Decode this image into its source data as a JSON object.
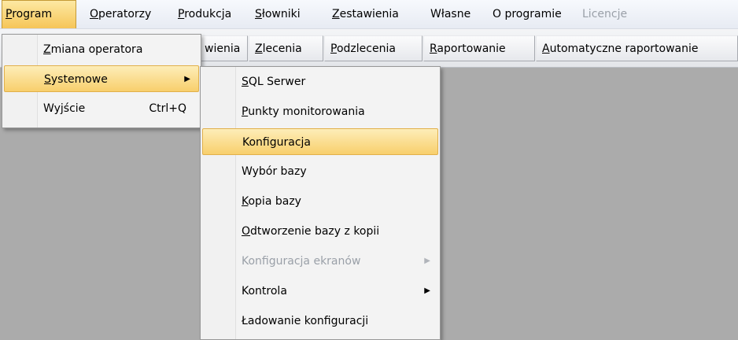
{
  "menubar": {
    "items": [
      {
        "label": "Program",
        "accel": "P",
        "rest": "rogram"
      },
      {
        "label": "Operatorzy",
        "accel": "O",
        "rest": "peratorzy"
      },
      {
        "label": "Produkcja",
        "accel": "P",
        "rest": "rodukcja"
      },
      {
        "label": "Słowniki",
        "accel": "S",
        "rest": "łowniki"
      },
      {
        "label": "Zestawienia",
        "accel": "Z",
        "rest": "estawienia"
      },
      {
        "label": "Własne"
      },
      {
        "label": "O programie"
      },
      {
        "label": "Licencje"
      }
    ]
  },
  "toolbar": {
    "buttons": [
      {
        "label": "wienia"
      },
      {
        "label": "Zlecenia",
        "accel": "Z",
        "rest": "lecenia"
      },
      {
        "label": "Podzlecenia",
        "accel": "P",
        "rest": "odzlecenia"
      },
      {
        "label": "Raportowanie",
        "accel": "R",
        "rest": "aportowanie"
      },
      {
        "label": "Automatyczne raportowanie",
        "accel": "A",
        "rest": "utomatyczne raportowanie"
      }
    ]
  },
  "program_menu": {
    "items": [
      {
        "accel": "Z",
        "rest": "miana operatora"
      },
      {
        "accel": "S",
        "rest": "ystemowe"
      },
      {
        "label": "Wyjście",
        "shortcut": "Ctrl+Q"
      }
    ]
  },
  "systemowe_menu": {
    "items": [
      {
        "accel": "S",
        "rest": "QL Serwer"
      },
      {
        "accel": "P",
        "rest": "unkty monitorowania"
      },
      {
        "label": "Konfiguracja"
      },
      {
        "label": "Wybór bazy"
      },
      {
        "accel": "K",
        "rest": "opia bazy"
      },
      {
        "accel": "O",
        "rest": "dtworzenie bazy z kopii"
      },
      {
        "label": "Konfiguracja ekranów"
      },
      {
        "label": "Kontrola"
      },
      {
        "label": "Ładowanie konfiguracji"
      }
    ]
  },
  "colors": {
    "highlight": "#f8cf6c",
    "workspace": "#ababab",
    "disabled_text": "#9aa0a8"
  },
  "icons": {
    "submenu_arrow": "right-triangle-icon"
  }
}
